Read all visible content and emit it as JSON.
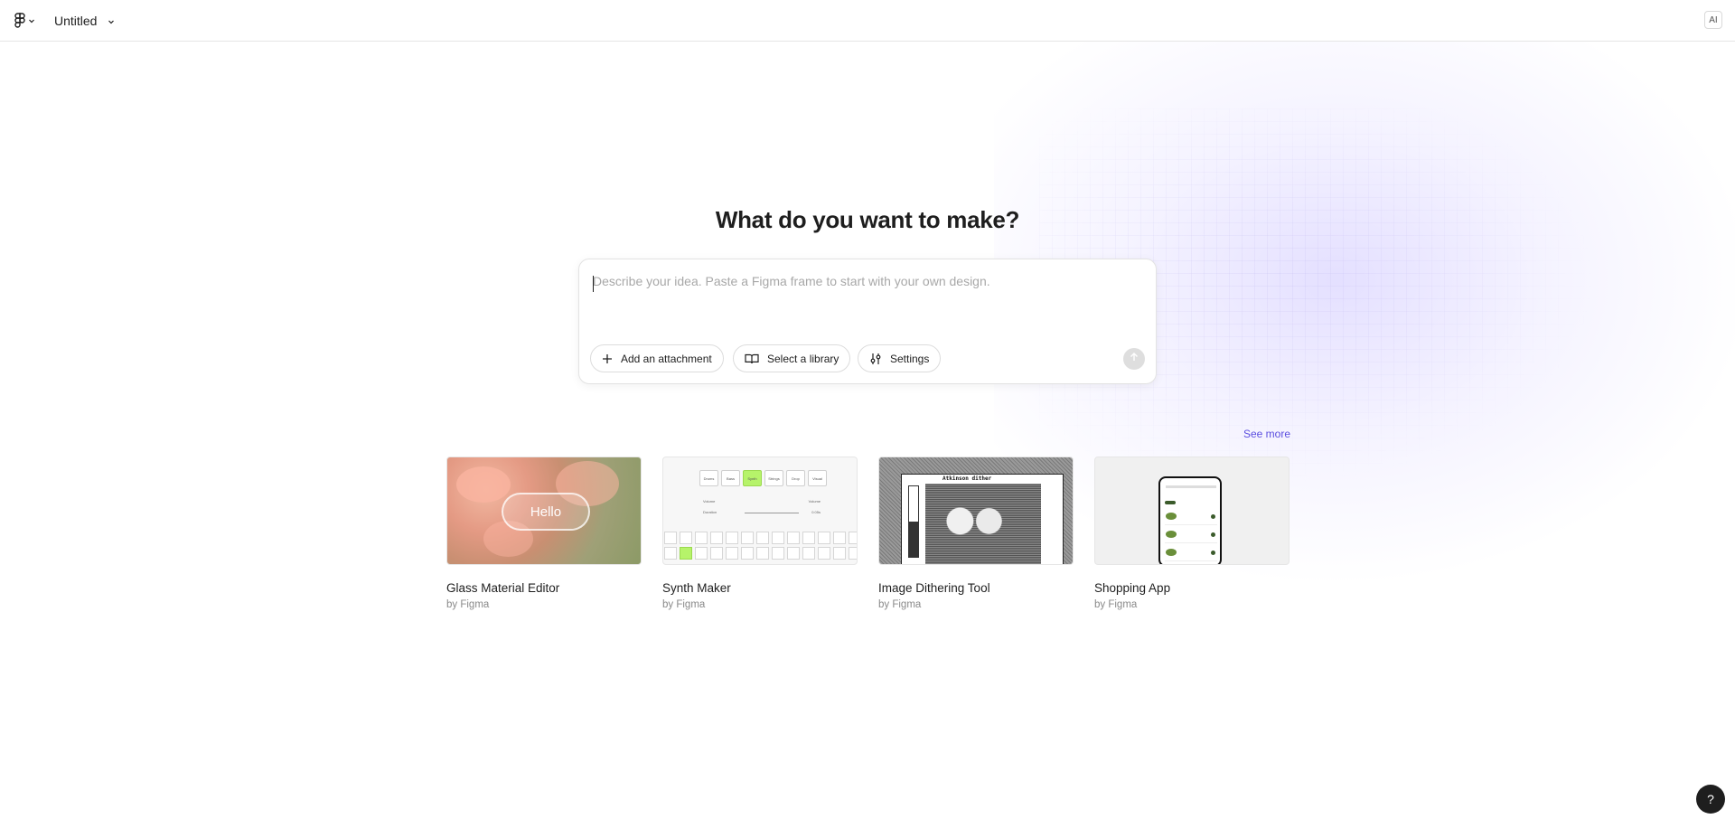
{
  "header": {
    "file_title": "Untitled",
    "ai_badge": "AI"
  },
  "main": {
    "heading": "What do you want to make?",
    "prompt": {
      "placeholder": "Describe your idea. Paste a Figma frame to start with your own design.",
      "value": "",
      "buttons": {
        "attachment": "Add an attachment",
        "library": "Select a library",
        "settings": "Settings"
      }
    },
    "see_more": "See more",
    "cards": [
      {
        "title": "Glass Material Editor",
        "by": "by Figma",
        "thumb_text": "Hello"
      },
      {
        "title": "Synth Maker",
        "by": "by Figma",
        "thumb_tabs": [
          "Drums",
          "Bass",
          "Synth",
          "Strings",
          "Drop",
          "Visual"
        ],
        "thumb_rows": [
          [
            "Volume",
            "Volume"
          ],
          [
            "Duration",
            "0.05s"
          ]
        ]
      },
      {
        "title": "Image Dithering Tool",
        "by": "by Figma",
        "thumb_title": "Atkinson dither"
      },
      {
        "title": "Shopping App",
        "by": "by Figma"
      }
    ]
  },
  "help": "?",
  "colors": {
    "accent_link": "#5b4ee0",
    "synth_active": "#b6f36a",
    "help_bg": "#1e1e1e"
  }
}
